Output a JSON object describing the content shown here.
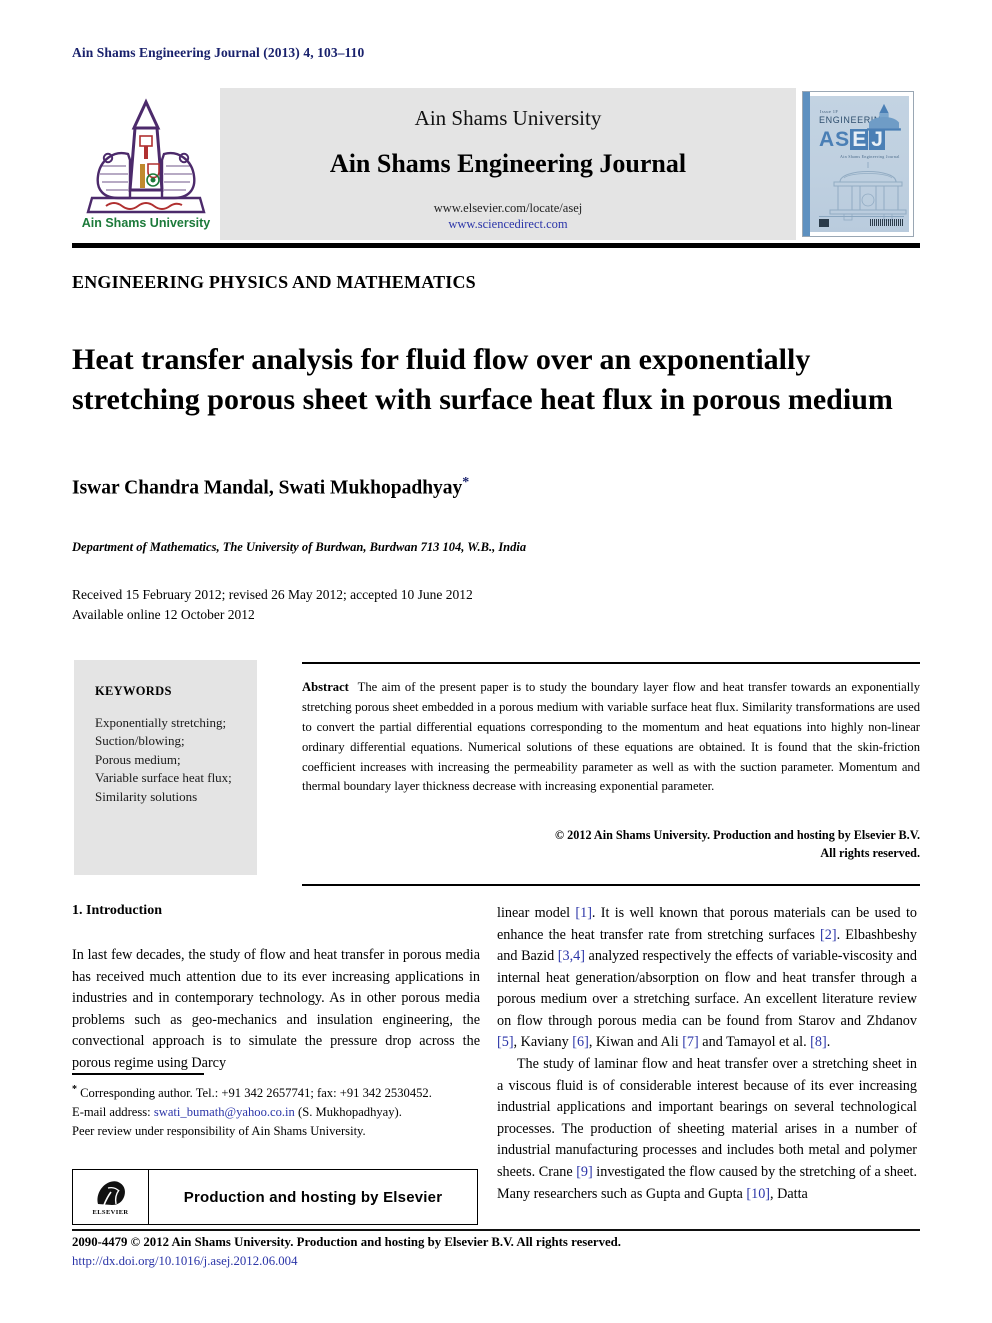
{
  "running_head": "Ain Shams Engineering Journal (2013) 4, 103–110",
  "masthead": {
    "logo_alt": "Ain Shams University",
    "logo_caption": "Ain Shams University",
    "university": "Ain Shams University",
    "journal": "Ain Shams Engineering Journal",
    "url_elsevier": "www.elsevier.com/locate/asej",
    "url_sciencedirect": "www.sciencedirect.com",
    "cover": {
      "top_small": "Issue 1F",
      "engineering": "ENGINEERING",
      "a": "A",
      "s": "S",
      "e": "E",
      "j": "J",
      "subtitle": "Ain Shams Engineering Journal"
    }
  },
  "section_label": "ENGINEERING PHYSICS AND MATHEMATICS",
  "title": "Heat transfer analysis for fluid flow over an exponentially stretching porous sheet with surface heat flux in porous medium",
  "authors": "Iswar Chandra Mandal, Swati Mukhopadhyay",
  "author_star": "*",
  "affiliation": "Department of Mathematics, The University of Burdwan, Burdwan 713 104, W.B., India",
  "dates": {
    "received": "Received 15 February 2012; revised 26 May 2012; accepted 10 June 2012",
    "available": "Available online 12 October 2012"
  },
  "keywords": {
    "heading": "KEYWORDS",
    "items": [
      "Exponentially stretching;",
      "Suction/blowing;",
      "Porous medium;",
      "Variable surface heat flux;",
      "Similarity solutions"
    ]
  },
  "abstract": {
    "label": "Abstract",
    "text": "The aim of the present paper is to study the boundary layer flow and heat transfer towards an exponentially stretching porous sheet embedded in a porous medium with variable surface heat flux. Similarity transformations are used to convert the partial differential equations corresponding to the momentum and heat equations into highly non-linear ordinary differential equations. Numerical solutions of these equations are obtained. It is found that the skin-friction coefficient increases with increasing the permeability parameter as well as with the suction parameter. Momentum and thermal boundary layer thickness decrease with increasing exponential parameter.",
    "copyright_line1": "© 2012 Ain Shams University. Production and hosting by Elsevier B.V.",
    "copyright_line2": "All rights reserved."
  },
  "body": {
    "intro_heading": "1. Introduction",
    "left_paragraph": "In last few decades, the study of flow and heat transfer in porous media has received much attention due to its ever increasing applications in industries and in contemporary technology. As in other porous media problems such as geo-mechanics and insulation engineering, the convectional approach is to simulate the pressure drop across the porous regime using Darcy",
    "right_paragraph_1_parts": [
      {
        "t": "linear model "
      },
      {
        "t": "[1]",
        "ref": true
      },
      {
        "t": ". It is well known that porous materials can be used to enhance the heat transfer rate from stretching surfaces "
      },
      {
        "t": "[2]",
        "ref": true
      },
      {
        "t": ". Elbashbeshy and Bazid "
      },
      {
        "t": "[3,4]",
        "ref": true
      },
      {
        "t": " analyzed respectively the effects of variable-viscosity and internal heat generation/absorption on flow and heat transfer through a porous medium over a stretching surface. An excellent literature review on flow through porous media can be found from Starov and Zhdanov "
      },
      {
        "t": "[5]",
        "ref": true
      },
      {
        "t": ", Kaviany "
      },
      {
        "t": "[6]",
        "ref": true
      },
      {
        "t": ", Kiwan and Ali "
      },
      {
        "t": "[7]",
        "ref": true
      },
      {
        "t": " and Tamayol et al. "
      },
      {
        "t": "[8]",
        "ref": true
      },
      {
        "t": "."
      }
    ],
    "right_paragraph_2_parts": [
      {
        "t": "The study of laminar flow and heat transfer over a stretching sheet in a viscous fluid is of considerable interest because of its ever increasing industrial applications and important bearings on several technological processes. The production of sheeting material arises in a number of industrial manufacturing processes and includes both metal and polymer sheets. Crane "
      },
      {
        "t": "[9]",
        "ref": true
      },
      {
        "t": " investigated the flow caused by the stretching of a sheet. Many researchers such as Gupta and Gupta "
      },
      {
        "t": "[10]",
        "ref": true
      },
      {
        "t": ", Datta"
      }
    ]
  },
  "footnotes": {
    "corresponding": "Corresponding author. Tel.: +91 342 2657741; fax: +91 342 2530452.",
    "email_label": "E-mail address:",
    "email": "swati_bumath@yahoo.co.in",
    "email_owner": "(S. Mukhopadhyay).",
    "peer_review": "Peer review under responsibility of Ain Shams University.",
    "elsevier_wordmark": "ELSEVIER",
    "elsevier_box_text": "Production and hosting by Elsevier"
  },
  "footer": {
    "issn_line": "2090-4479 © 2012 Ain Shams University. Production and hosting by Elsevier B.V. All rights reserved.",
    "doi": "http://dx.doi.org/10.1016/j.asej.2012.06.004"
  },
  "colors": {
    "link": "#2b35a8",
    "running_head": "#19216c",
    "panel_gray": "#e4e4e4",
    "logo_purple": "#4c2a6b",
    "logo_green": "#1c7a3a",
    "cover_blue": "#4a7fb5"
  }
}
